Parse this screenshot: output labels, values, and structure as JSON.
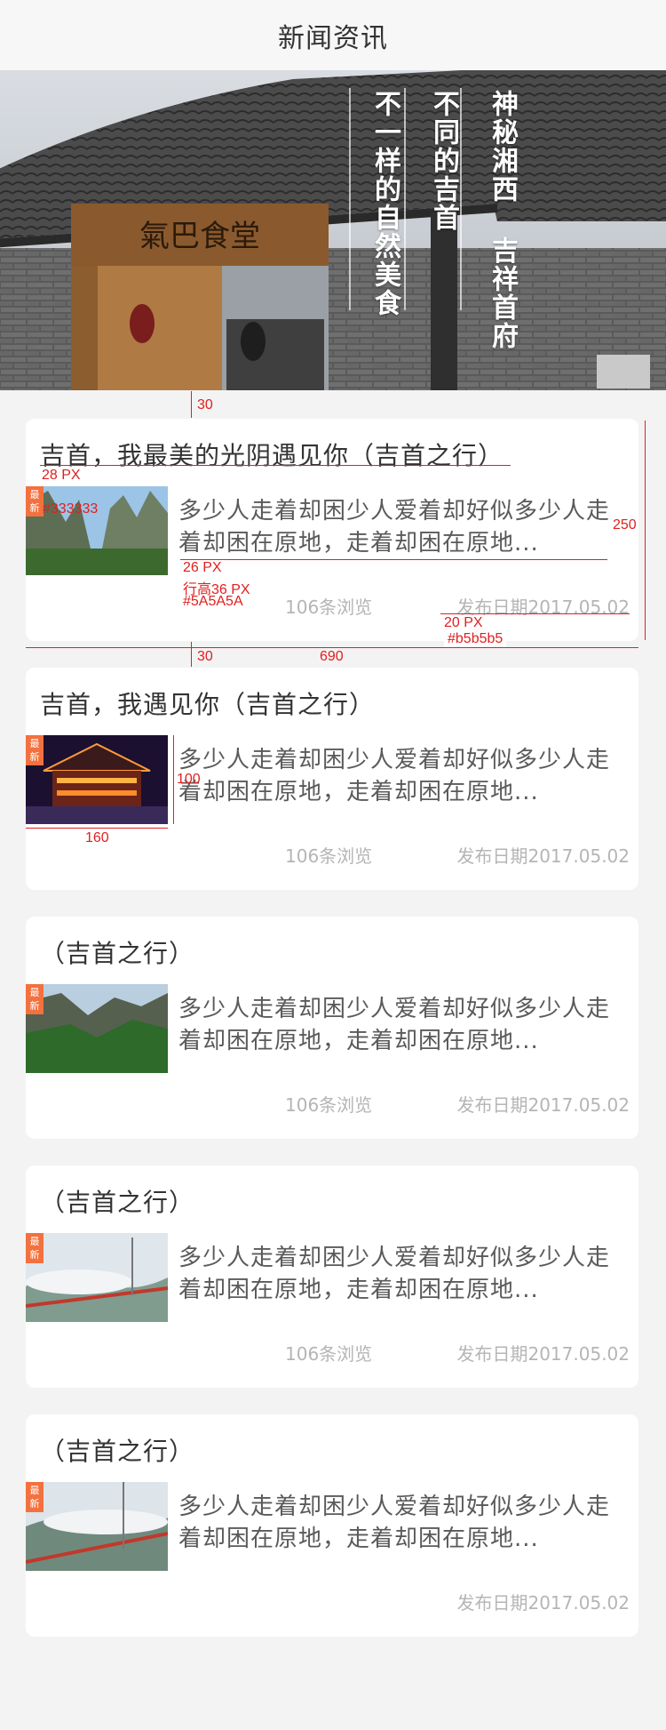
{
  "header": {
    "title": "新闻资讯"
  },
  "banner": {
    "sign_text": "氣巴食堂",
    "columns": [
      "神秘湘西 吉祥首府",
      "不同的吉首",
      "不一样的自然美食"
    ]
  },
  "badge": {
    "label": "最新"
  },
  "news": [
    {
      "title": "吉首，我最美的光阴遇见你（吉首之行）",
      "summary": "多少人走着却困少人爱着却好似多少人走着却困在原地，走着却困在原地...",
      "views": "106条浏览",
      "date": "发布日期2017.05.02"
    },
    {
      "title": "吉首，我遇见你（吉首之行）",
      "summary": "多少人走着却困少人爱着却好似多少人走着却困在原地，走着却困在原地...",
      "views": "106条浏览",
      "date": "发布日期2017.05.02"
    },
    {
      "title": "（吉首之行）",
      "summary": "多少人走着却困少人爱着却好似多少人走着却困在原地，走着却困在原地...",
      "views": "106条浏览",
      "date": "发布日期2017.05.02"
    },
    {
      "title": "（吉首之行）",
      "summary": "多少人走着却困少人爱着却好似多少人走着却困在原地，走着却困在原地...",
      "views": "106条浏览",
      "date": "发布日期2017.05.02"
    },
    {
      "title": "（吉首之行）",
      "summary": "多少人走着却困少人爱着却好似多少人走着却困在原地，走着却困在原地...",
      "views": "",
      "date": "发布日期2017.05.02"
    }
  ],
  "annotations": {
    "gap_top": "30",
    "title_size": "28 PX",
    "title_color": "#333333",
    "summary_size": "26 PX",
    "summary_lineheight": "行高36 PX",
    "summary_color": "#5A5A5A",
    "card_height": "250",
    "meta_size": "20 PX",
    "meta_color": "#b5b5b5",
    "gap_between": "30",
    "card_width": "690",
    "thumb_height": "100",
    "thumb_width": "160"
  },
  "colors": {
    "accent": "#f3713e",
    "title": "#333333",
    "summary": "#5A5A5A",
    "meta": "#b5b5b5",
    "annotation": "#e02020"
  }
}
